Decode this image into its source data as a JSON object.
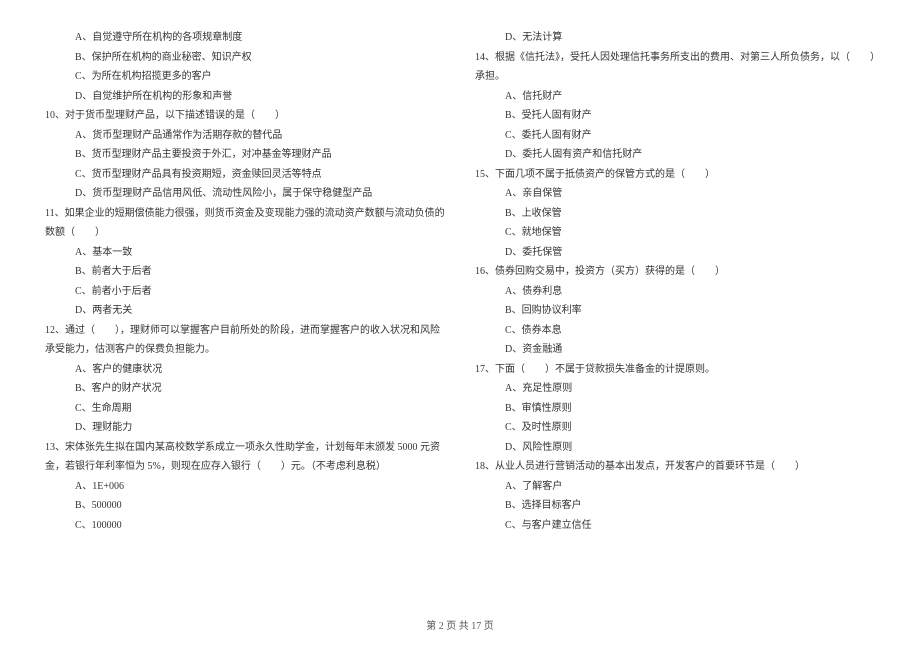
{
  "left_column": {
    "q9_options": {
      "a": "A、自觉遵守所在机构的各项规章制度",
      "b": "B、保护所在机构的商业秘密、知识产权",
      "c": "C、为所在机构招揽更多的客户",
      "d": "D、自觉维护所在机构的形象和声誉"
    },
    "q10": {
      "text": "10、对于货币型理财产品，以下描述错误的是（　　）",
      "a": "A、货币型理财产品通常作为活期存款的替代品",
      "b": "B、货币型理财产品主要投资于外汇，对冲基金等理财产品",
      "c": "C、货币型理财产品具有投资期短，资金赎回灵活等特点",
      "d": "D、货币型理财产品信用风低、流动性风险小，属于保守稳健型产品"
    },
    "q11": {
      "text": "11、如果企业的短期偿债能力很强，则货币资金及变现能力强的流动资产数额与流动负债的数额（　　）",
      "a": "A、基本一致",
      "b": "B、前者大于后者",
      "c": "C、前者小于后者",
      "d": "D、两者无关"
    },
    "q12": {
      "text": "12、通过（　　），理财师可以掌握客户目前所处的阶段，进而掌握客户的收入状况和风险承受能力，估测客户的保费负担能力。",
      "a": "A、客户的健康状况",
      "b": "B、客户的财产状况",
      "c": "C、生命周期",
      "d": "D、理财能力"
    },
    "q13": {
      "text": "13、宋体张先生拟在国内某高校数学系成立一项永久性助学金，计划每年末颁发 5000 元资金，若银行年利率恒为 5%，则现在应存入银行（　　）元。（不考虑利息税）",
      "a": "A、1E+006",
      "b": "B、500000",
      "c": "C、100000"
    }
  },
  "right_column": {
    "q13_d": "D、无法计算",
    "q14": {
      "text": "14、根据《信托法》，受托人因处理信托事务所支出的费用、对第三人所负债务，以（　　）承担。",
      "a": "A、信托财产",
      "b": "B、受托人固有财产",
      "c": "C、委托人固有财产",
      "d": "D、委托人固有资产和信托财产"
    },
    "q15": {
      "text": "15、下面几项不属于抵债资产的保管方式的是（　　）",
      "a": "A、亲自保管",
      "b": "B、上收保管",
      "c": "C、就地保管",
      "d": "D、委托保管"
    },
    "q16": {
      "text": "16、债券回购交易中，投资方（买方）获得的是（　　）",
      "a": "A、债券利息",
      "b": "B、回购协议利率",
      "c": "C、债券本息",
      "d": "D、资金融通"
    },
    "q17": {
      "text": "17、下面（　　）不属于贷款损失准备金的计提原则。",
      "a": "A、充足性原则",
      "b": "B、审慎性原则",
      "c": "C、及时性原则",
      "d": "D、风险性原则"
    },
    "q18": {
      "text": "18、从业人员进行营销活动的基本出发点，开发客户的首要环节是（　　）",
      "a": "A、了解客户",
      "b": "B、选择目标客户",
      "c": "C、与客户建立信任"
    }
  },
  "footer": "第 2 页 共 17 页"
}
